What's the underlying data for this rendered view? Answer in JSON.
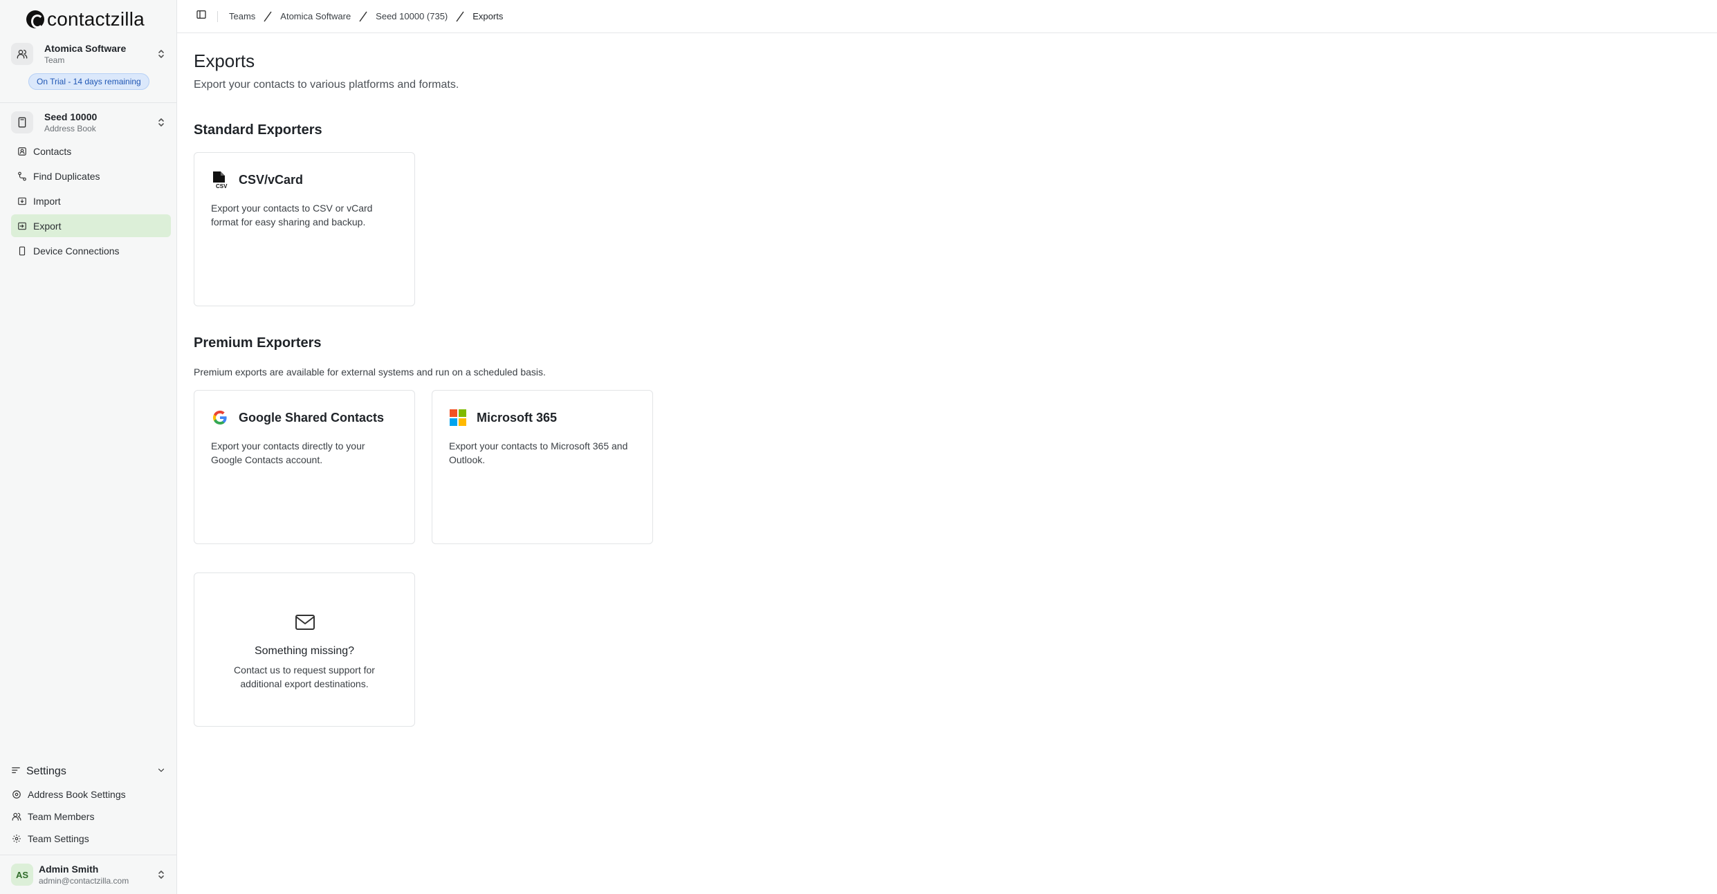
{
  "app": {
    "logo_text": "contactzilla"
  },
  "team_switcher": {
    "name": "Atomica Software",
    "type": "Team",
    "trial_badge": "On Trial - 14 days remaining"
  },
  "addressbook_switcher": {
    "name": "Seed 10000",
    "type": "Address Book"
  },
  "nav": {
    "items": [
      {
        "label": "Contacts",
        "icon": "contacts-icon",
        "active": false
      },
      {
        "label": "Find Duplicates",
        "icon": "duplicates-icon",
        "active": false
      },
      {
        "label": "Import",
        "icon": "import-icon",
        "active": false
      },
      {
        "label": "Export",
        "icon": "export-icon",
        "active": true
      },
      {
        "label": "Device Connections",
        "icon": "device-icon",
        "active": false
      }
    ]
  },
  "settings": {
    "label": "Settings",
    "items": [
      {
        "label": "Address Book Settings",
        "icon": "address-book-settings-icon"
      },
      {
        "label": "Team Members",
        "icon": "team-members-icon"
      },
      {
        "label": "Team Settings",
        "icon": "gear-icon"
      }
    ]
  },
  "user": {
    "initials": "AS",
    "name": "Admin Smith",
    "email": "admin@contactzilla.com"
  },
  "breadcrumb": [
    "Teams",
    "Atomica Software",
    "Seed 10000 (735)",
    "Exports"
  ],
  "page": {
    "title": "Exports",
    "description": "Export your contacts to various platforms and formats."
  },
  "standard": {
    "title": "Standard Exporters",
    "cards": [
      {
        "title": "CSV/vCard",
        "icon": "csv-file-icon",
        "description": "Export your contacts to CSV or vCard format for easy sharing and backup."
      }
    ]
  },
  "premium": {
    "title": "Premium Exporters",
    "description": "Premium exports are available for external systems and run on a scheduled basis.",
    "cards": [
      {
        "title": "Google Shared Contacts",
        "icon": "google-icon",
        "description": "Export your contacts directly to your Google Contacts account."
      },
      {
        "title": "Microsoft 365",
        "icon": "microsoft-icon",
        "description": "Export your contacts to Microsoft 365 and Outlook."
      }
    ]
  },
  "missing": {
    "title": "Something missing?",
    "description": "Contact us to request support for additional export destinations.",
    "icon": "mail-icon"
  },
  "colors": {
    "active_nav_bg": "#dcefd8",
    "trial_badge_bg": "#dbe8fb",
    "trial_badge_text": "#1f56b4",
    "sidebar_bg": "#f6f7f7"
  }
}
